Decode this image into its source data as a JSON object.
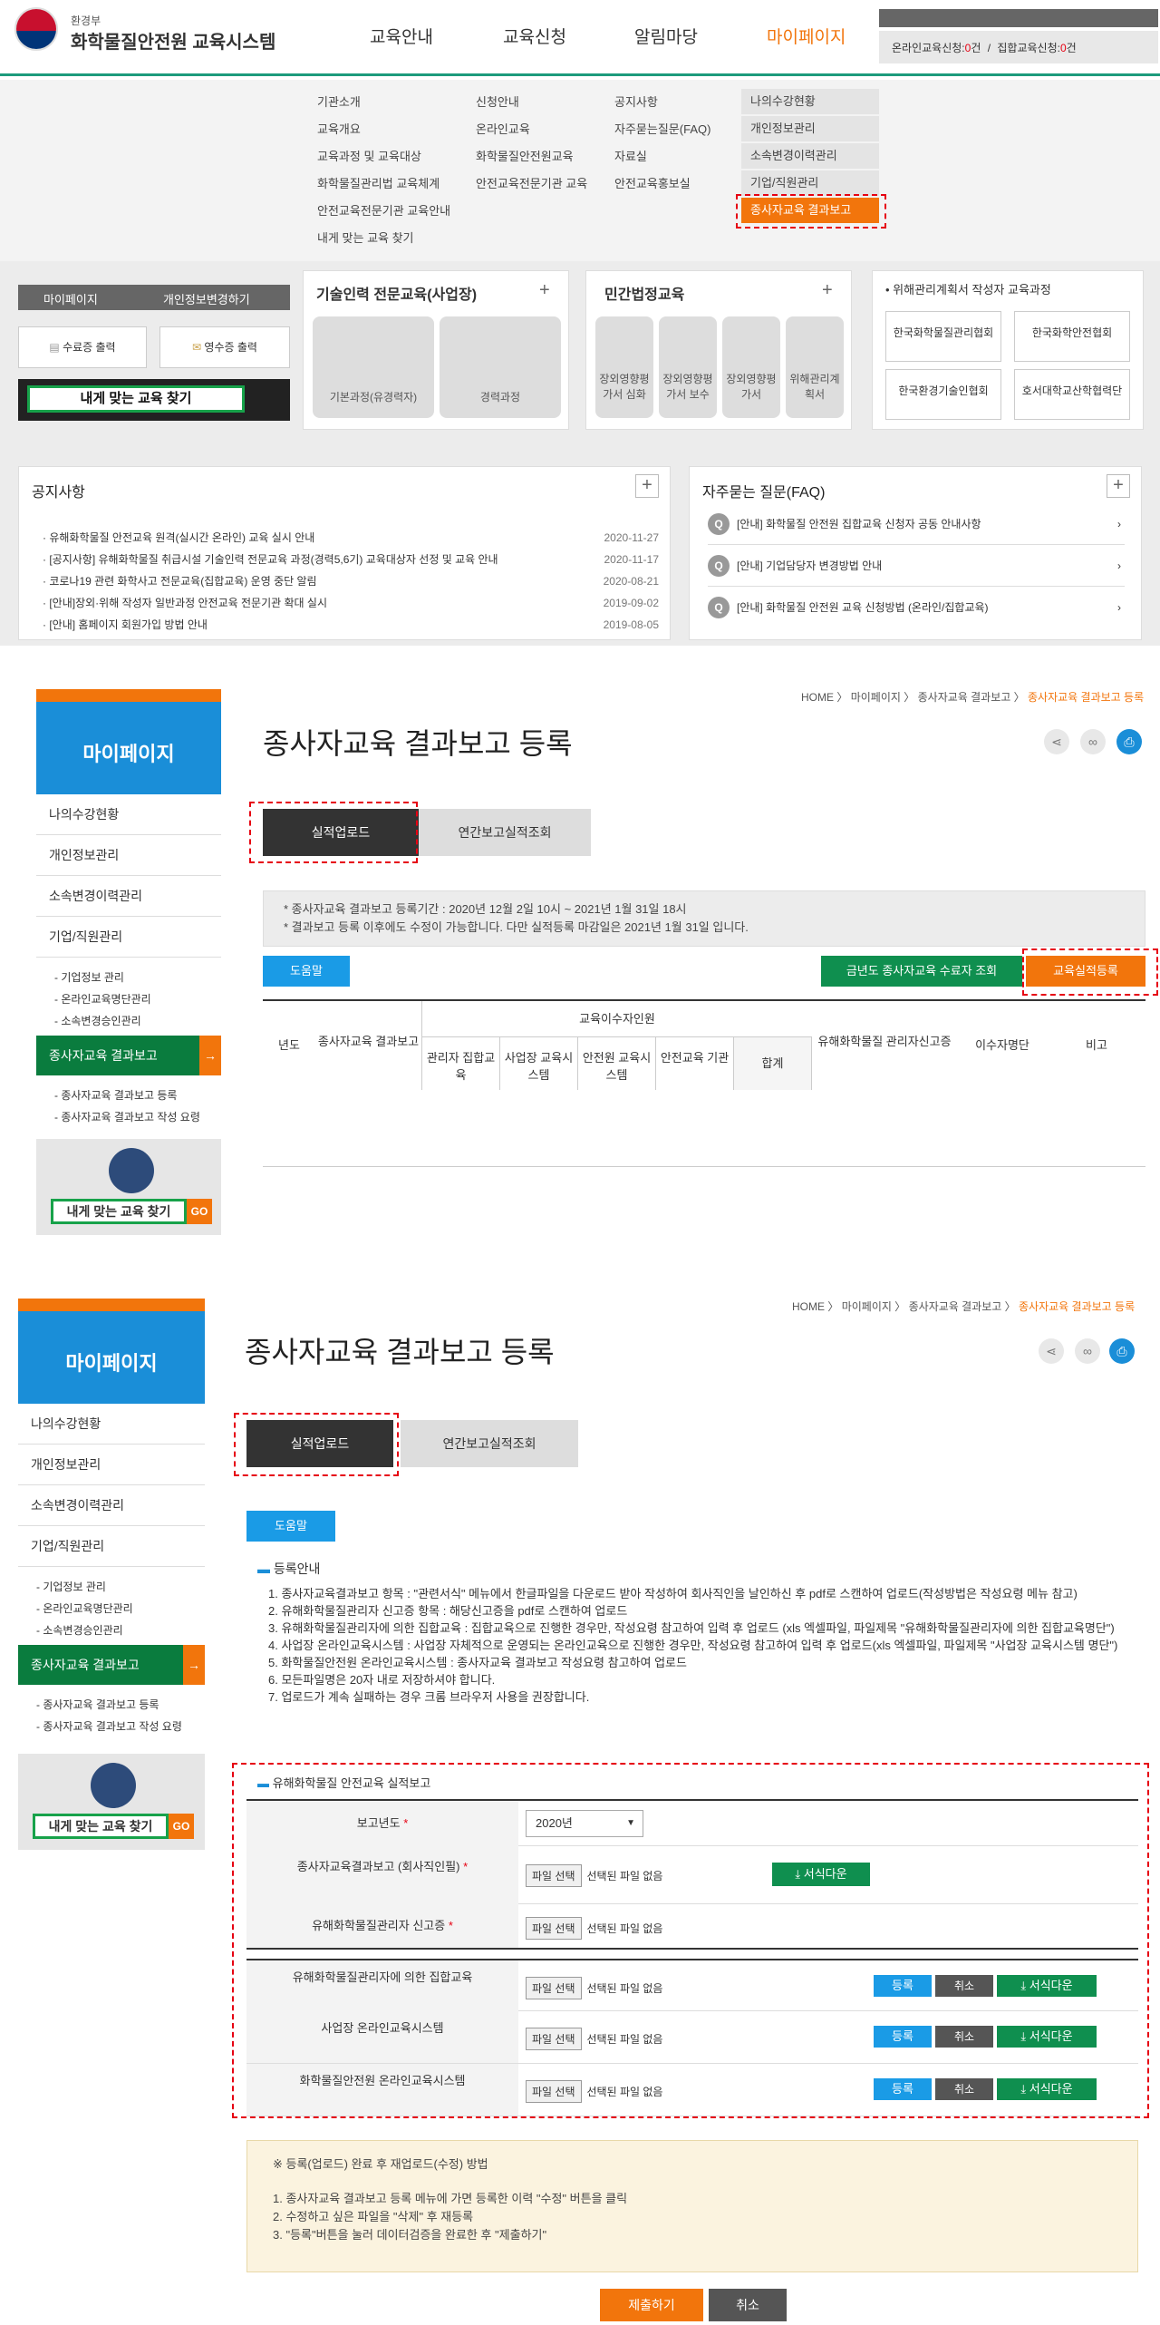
{
  "header": {
    "logo_sub": "환경부",
    "logo_main": "화학물질안전원 교육시스템",
    "nav": [
      "교육안내",
      "교육신청",
      "알림마당",
      "마이페이지"
    ],
    "status_online_label": "온라인교육신청:",
    "status_online_value": "0",
    "status_unit": "건",
    "status_sep": "/",
    "status_group_label": "집합교육신청:",
    "status_group_value": "0"
  },
  "megamenu": {
    "col1": [
      "기관소개",
      "교육개요",
      "교육과정 및 교육대상",
      "화학물질관리법 교육체계",
      "안전교육전문기관 교육안내",
      "내게 맞는 교육 찾기"
    ],
    "col2": [
      "신청안내",
      "온라인교육",
      "화학물질안전원교육",
      "안전교육전문기관 교육"
    ],
    "col3": [
      "공지사항",
      "자주묻는질문(FAQ)",
      "자료실",
      "안전교육홍보실"
    ],
    "col4": [
      "나의수강현황",
      "개인정보관리",
      "소속변경이력관리",
      "기업/직원관리",
      "종사자교육 결과보고"
    ]
  },
  "strip": {
    "mypage": "마이페이지",
    "change_info": "개인정보변경하기",
    "cert_print": "수료증 출력",
    "receipt_print": "영수증 출력",
    "find_edu": "내게 맞는 교육 찾기",
    "tech_title": "기술인력 전문교육(사업장)",
    "tech_items": [
      "기본과정(유경력자)",
      "경력과정"
    ],
    "legal_title": "민간법정교육",
    "legal_items": [
      "장외영향평가서 심화",
      "장외영향평가서 보수",
      "장외영향평가서",
      "위해관리계획서"
    ],
    "risk_title": "• 위해관리계획서 작성자 교육과정",
    "orgs": [
      "한국화학물질관리협회",
      "한국화학안전협회",
      "한국환경기술인협회",
      "호서대학교산학협력단"
    ]
  },
  "notice": {
    "title": "공지사항",
    "items": [
      {
        "text": "· 유해화학물질 안전교육 원격(실시간 온라인) 교육 실시 안내",
        "date": "2020-11-27"
      },
      {
        "text": "· [공지사항] 유해화학물질 취급시설 기술인력 전문교육 과정(경력5,6기) 교육대상자 선정 및 교육 안내",
        "date": "2020-11-17"
      },
      {
        "text": "· 코로나19 관련 화학사고 전문교육(집합교육) 운영 중단 알림",
        "date": "2020-08-21"
      },
      {
        "text": "· [안내]장외·위해 작성자 일반과정 안전교육 전문기관 확대 실시",
        "date": "2019-09-02"
      },
      {
        "text": "· [안내] 홈페이지 회원가입 방법 안내",
        "date": "2019-08-05"
      }
    ]
  },
  "faq": {
    "title": "자주묻는 질문(FAQ)",
    "items": [
      "[안내] 화학물질 안전원 집합교육 신청자 공동 안내사항",
      "[안내] 기업담당자 변경방법 안내",
      "[안내] 화학물질 안전원 교육 신청방법 (온라인/집합교육)"
    ]
  },
  "side": {
    "title": "마이페이지",
    "items": [
      "나의수강현황",
      "개인정보관리",
      "소속변경이력관리",
      "기업/직원관리"
    ],
    "sub1": [
      "- 기업정보 관리",
      "- 온라인교육명단관리",
      "- 소속변경승인관리"
    ],
    "selected": "종사자교육 결과보고",
    "arrow": "→",
    "sub2": [
      "- 종사자교육 결과보고 등록",
      "- 종사자교육 결과보고 작성 요령"
    ],
    "banner": "내게 맞는 교육 찾기",
    "go": "GO"
  },
  "page": {
    "crumb_home": "HOME",
    "crumb_sep": "〉",
    "crumb_mypage": "마이페이지",
    "crumb_report": "종사자교육 결과보고",
    "crumb_current": "종사자교육 결과보고 등록",
    "title": "종사자교육 결과보고 등록",
    "tab_upload": "실적업로드",
    "tab_annual": "연간보고실적조회",
    "info1": "* 종사자교육 결과보고 등록기간 : 2020년 12월 2일 10시 ~ 2021년 1월 31일 18시",
    "info2": "* 결과보고 등록 이후에도 수정이 가능합니다. 다만 실적등록 마감일은 2021년 1월 31일 입니다.",
    "help": "도움말",
    "btn_lookup": "금년도 종사자교육 수료자 조회",
    "btn_register": "교육실적등록",
    "th_year": "년도",
    "th_report": "종사자교육 결과보고",
    "th_completers": "교육이수자인원",
    "th_sub": [
      "관리자 집합교육",
      "사업장 교육시스템",
      "안전원 교육시스템",
      "안전교육 기관",
      "합계"
    ],
    "th_cert": "유해화학물질 관리자신고증",
    "th_list": "이수자명단",
    "th_note": "비고"
  },
  "register": {
    "guide_title": "등록안내",
    "guide": [
      "1. 종사자교육결과보고 항목 : \"관련서식\" 메뉴에서 한글파일을 다운로드 받아 작성하여 회사직인을 날인하신 후 pdf로 스캔하여 업로드(작성방법은 작성요령 메뉴 참고)",
      "2. 유해화학물질관리자 신고증 항목 : 해당신고증을 pdf로 스캔하여 업로드",
      "3. 유해화학물질관리자에 의한 집합교육 : 집합교육으로 진행한 경우만, 작성요령 참고하여 입력 후 업로드 (xls 엑셀파일, 파일제목 \"유해화학물질관리자에 의한 집합교육명단\")",
      "4. 사업장 온라인교육시스템 : 사업장 자체적으로 운영되는 온라인교육으로 진행한 경우만, 작성요령 참고하여 입력 후 업로드(xls 엑셀파일, 파일제목 \"사업장 교육시스템 명단\")",
      "5. 화학물질안전원 온라인교육시스템 : 종사자교육 결과보고 작성요령 참고하여 업로드",
      "6. 모든파일명은 20자 내로 저장하셔야 합니다.",
      "7. 업로드가 계속 실패하는 경우 크롬 브라우저 사용을 권장합니다."
    ],
    "form_title": "유해화학물질 안전교육 실적보고",
    "year_label": "보고년도",
    "year_value": "2020년",
    "required": "*",
    "report_label": "종사자교육결과보고 (회사직인필)",
    "cert_label": "유해화학물질관리자 신고증",
    "file_btn": "파일 선택",
    "no_file": "선택된 파일 없음",
    "form_download": "서식다운",
    "group_label": "유해화학물질관리자에 의한 집합교육",
    "workplace_label": "사업장 온라인교육시스템",
    "kiost_label": "화학물질안전원 온라인교육시스템",
    "btn_reg": "등록",
    "btn_cancel": "취소",
    "note_title": "※ 등록(업로드) 완료 후 재업로드(수정) 방법",
    "notes": [
      "1. 종사자교육 결과보고 등록 메뉴에 가면 등록한 이력 \"수정\" 버튼을 클릭",
      "2. 수정하고 싶은 파일을 \"삭제\" 후 재등록",
      "3. \"등록\"버튼을 눌러 데이터검증을 완료한 후 \"제출하기\""
    ],
    "submit": "제출하기",
    "cancel": "취소"
  }
}
